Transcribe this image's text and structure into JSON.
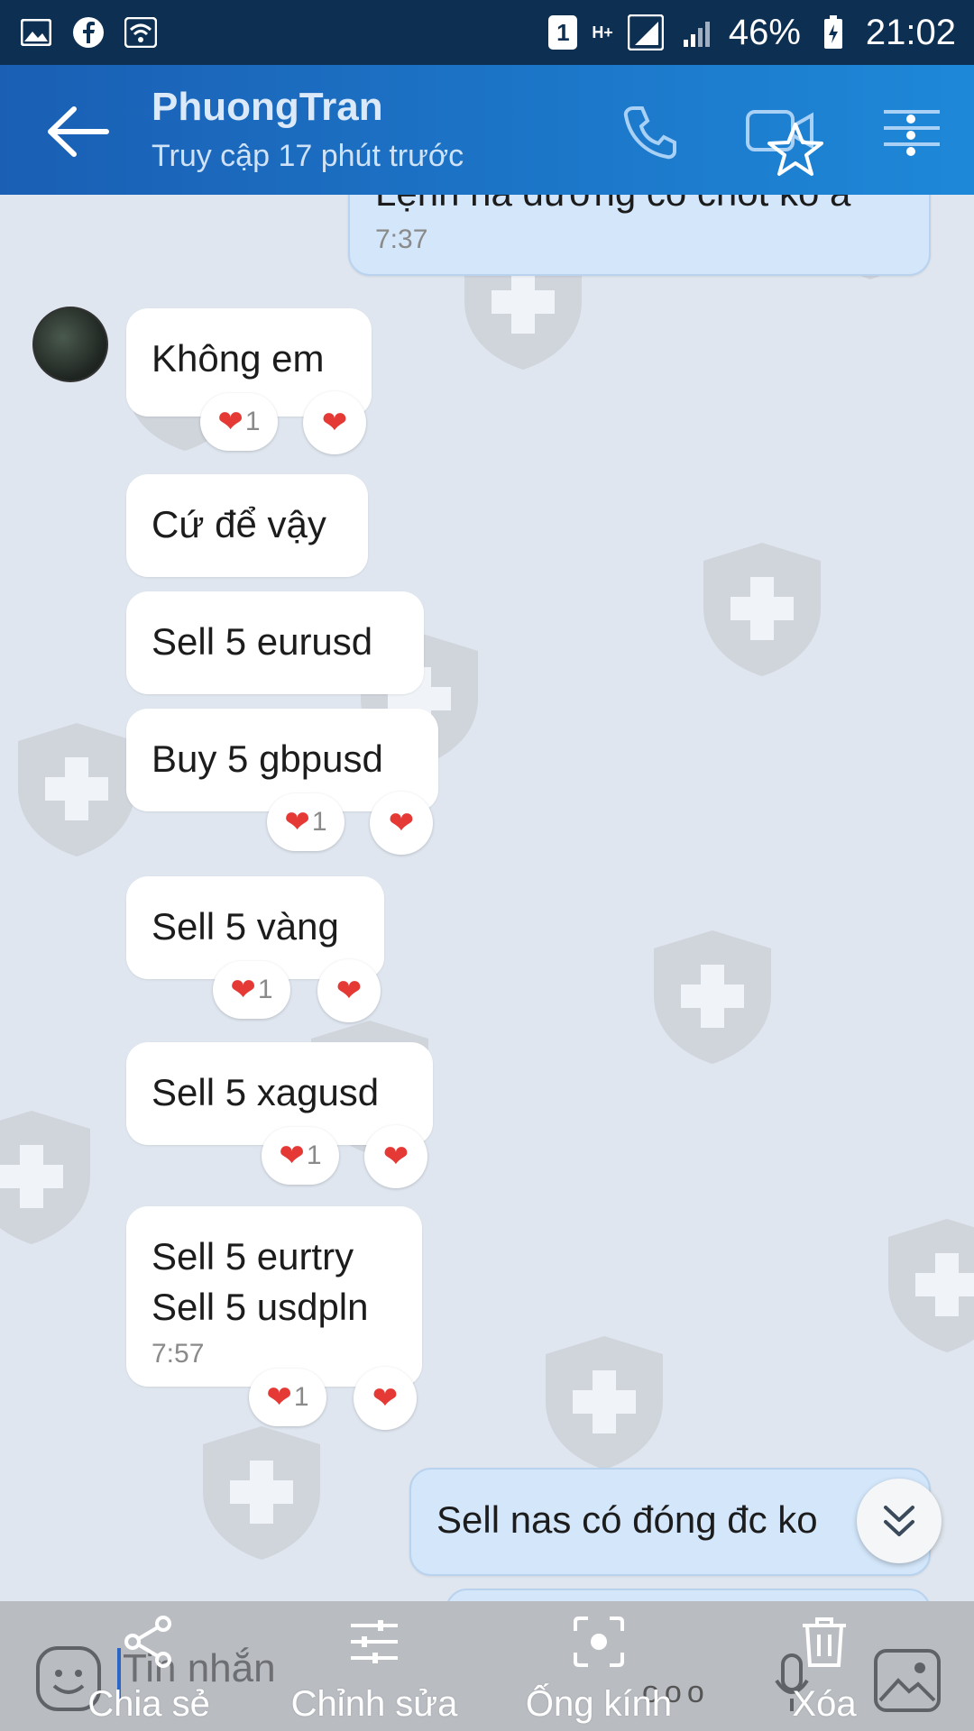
{
  "status_bar": {
    "sim_slot": "1",
    "network_type": "H+",
    "battery": "46%",
    "time": "21:02",
    "icons": [
      "gallery-icon",
      "facebook-icon",
      "wifi-icon",
      "signal-icon",
      "battery-icon"
    ]
  },
  "header": {
    "contact_name": "PhuongTran",
    "last_seen": "Truy cập 17 phút trước",
    "icons": [
      "back-arrow-icon",
      "phone-icon",
      "video-call-icon",
      "star-icon",
      "menu-icon"
    ]
  },
  "messages": [
    {
      "id": "m0",
      "direction": "out",
      "text": "Lệnh ná đường có chốt ko á",
      "time": "7:37"
    },
    {
      "id": "m1",
      "direction": "in",
      "text": "Không em",
      "reaction_count": "1"
    },
    {
      "id": "m2",
      "direction": "in",
      "text": "Cứ để vậy"
    },
    {
      "id": "m3",
      "direction": "in",
      "text": "Sell 5 eurusd"
    },
    {
      "id": "m4",
      "direction": "in",
      "text": "Buy 5 gbpusd",
      "reaction_count": "1"
    },
    {
      "id": "m5",
      "direction": "in",
      "text": "Sell 5 vàng",
      "reaction_count": "1"
    },
    {
      "id": "m6",
      "direction": "in",
      "text": "Sell 5 xagusd",
      "reaction_count": "1"
    },
    {
      "id": "m7",
      "direction": "in",
      "line1": "Sell 5 eurtry",
      "line2": "Sell 5 usdpln",
      "time": "7:57",
      "reaction_count": "1"
    },
    {
      "id": "m8",
      "direction": "out",
      "text": "Sell nas có đóng đc ko"
    }
  ],
  "composer": {
    "placeholder": "Tin nhắn"
  },
  "actions": [
    {
      "label": "Chia sẻ",
      "icon": "share-icon"
    },
    {
      "label": "Chỉnh sửa",
      "icon": "adjust-icon"
    },
    {
      "label": "Ống kính",
      "icon": "lens-icon"
    },
    {
      "label": "Xóa",
      "icon": "trash-icon"
    }
  ],
  "colors": {
    "header": "#1e88d8",
    "chat_background": "#dfe6ef",
    "outgoing_bubble": "#d3e6fa",
    "heart": "#e53935"
  }
}
